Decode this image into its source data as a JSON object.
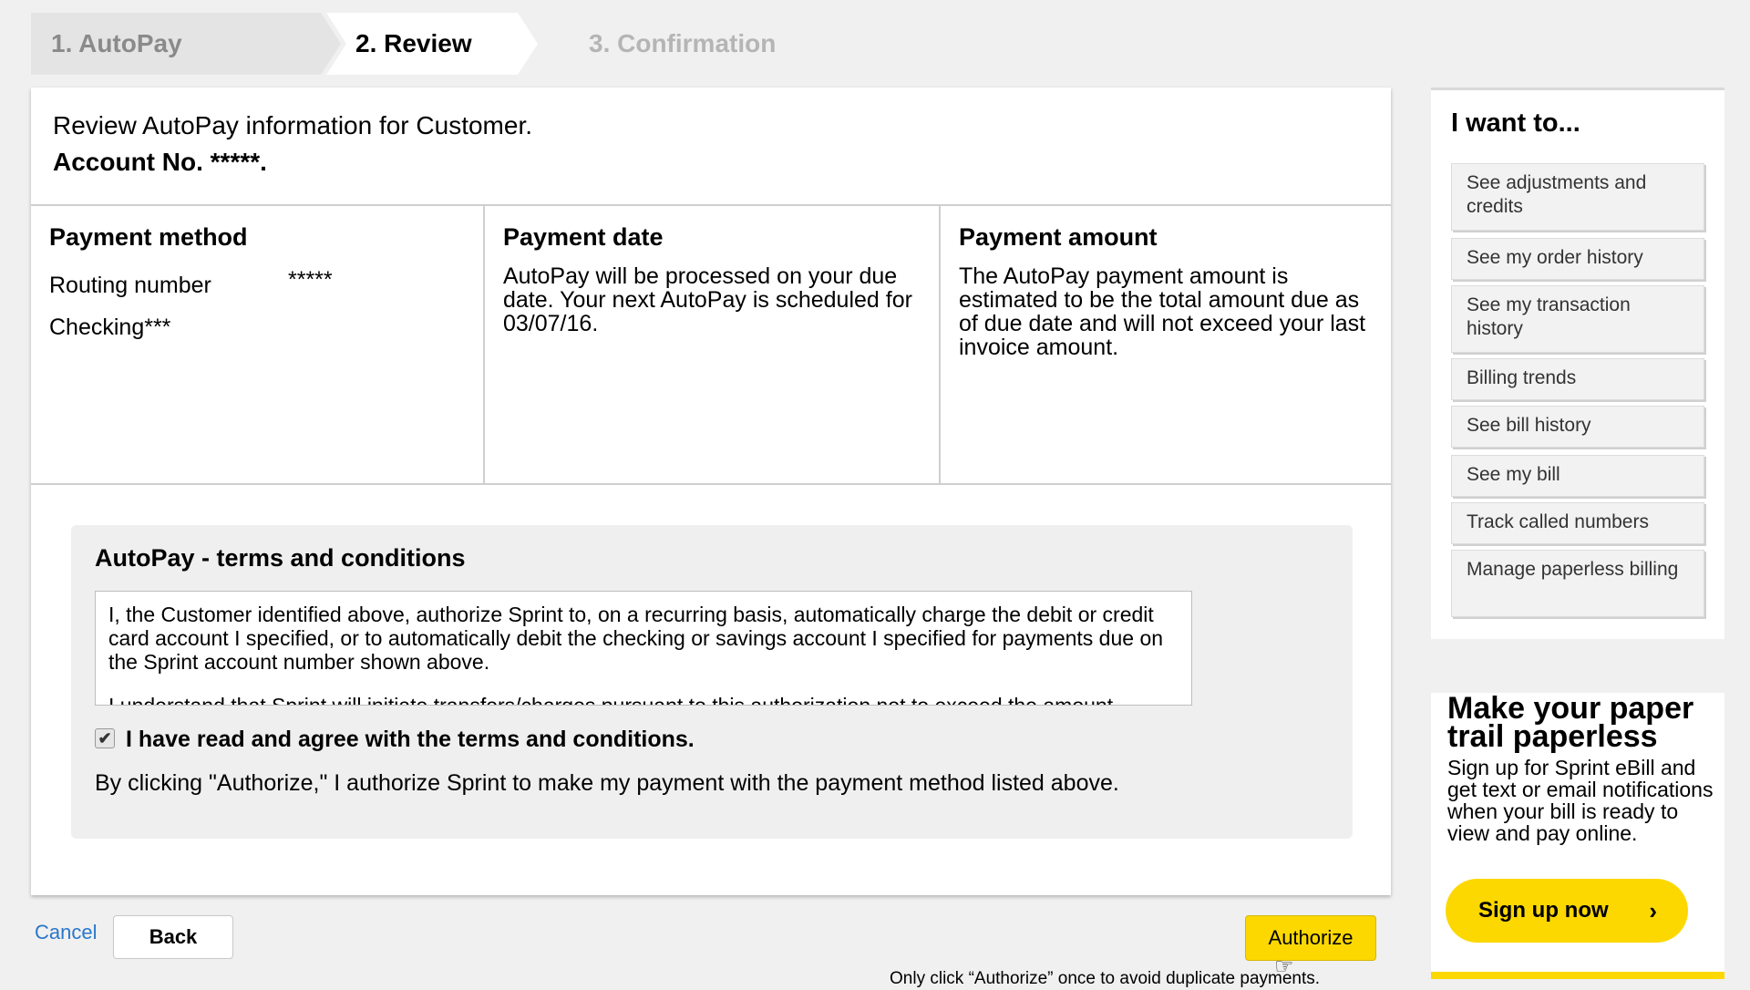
{
  "stepper": {
    "step1": "1. AutoPay",
    "step2": "2. Review",
    "step3": "3. Confirmation"
  },
  "intro": {
    "line1": "Review AutoPay information for Customer.",
    "line2": "Account No. *****."
  },
  "payment_method": {
    "heading": "Payment method",
    "routing_label": "Routing number",
    "routing_value": "*****",
    "account_type": "Checking***"
  },
  "payment_date": {
    "heading": "Payment date",
    "text": "AutoPay will be processed on your due date. Your next AutoPay is scheduled for 03/07/16."
  },
  "payment_amount": {
    "heading": "Payment amount",
    "text": "The AutoPay payment amount is estimated to be the total amount due as of due date and will not exceed your last invoice amount."
  },
  "terms": {
    "heading": "AutoPay - terms and conditions",
    "paragraph1": "I, the Customer identified above, authorize Sprint to, on a recurring basis, automatically charge the debit or credit card account I specified, or to automatically debit the checking or savings account I specified for payments due on the Sprint account number shown above.",
    "paragraph2": "I understand that Sprint will initiate transfers/charges pursuant to this authorization not to exceed the amount",
    "agree_label": "I have read and agree with the terms and conditions.",
    "agree_checked": true,
    "authorize_note": "By clicking \"Authorize,\" I authorize Sprint to make my payment with the payment method listed above."
  },
  "actions": {
    "cancel": "Cancel",
    "back": "Back",
    "authorize": "Authorize",
    "warning": "Only click “Authorize” once to avoid duplicate payments."
  },
  "sidebar": {
    "title": "I want to...",
    "items": [
      "See adjustments and credits",
      "See my order history",
      "See my transaction history",
      "Billing trends",
      "See bill history",
      "See my bill",
      "Track called numbers",
      "Manage paperless billing"
    ]
  },
  "promo": {
    "title": "Make your paper trail paperless",
    "body": "Sign up for Sprint eBill and get text or email notifications when your bill is ready to view and pay online.",
    "button": "Sign up now"
  },
  "colors": {
    "accent_yellow": "#fcd800",
    "link_blue": "#2a77c9"
  }
}
